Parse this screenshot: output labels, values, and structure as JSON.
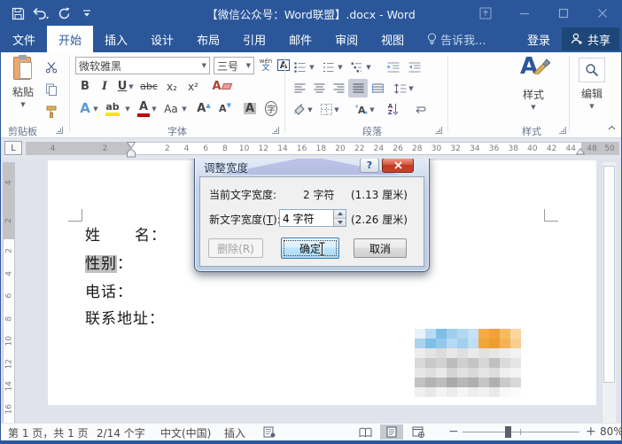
{
  "window": {
    "title": "【微信公众号：Word联盟】.docx - Word"
  },
  "tabs": {
    "file": "文件",
    "home": "开始",
    "insert": "插入",
    "design": "设计",
    "layout": "布局",
    "references": "引用",
    "mailings": "邮件",
    "review": "审阅",
    "view": "视图",
    "tell_me": "告诉我...",
    "sign_in": "登录",
    "share": "共享"
  },
  "ribbon": {
    "clipboard": {
      "paste": "粘贴",
      "label": "剪贴板"
    },
    "font": {
      "label": "字体",
      "font_name": "微软雅黑",
      "font_size": "三号",
      "bold": "B",
      "italic": "I",
      "underline": "U",
      "strikethrough": "abc",
      "subscript": "x₂",
      "superscript": "x²",
      "change_case": "Aa",
      "phonetic_top": "wén",
      "phonetic_bottom": "文",
      "effects_a": "A",
      "highlight_ab": "ab",
      "color_a": "A",
      "grow_a": "A",
      "shrink_a": "A",
      "shade_a": "A",
      "border_a": "A",
      "enclose": "字"
    },
    "paragraph": {
      "label": "段落",
      "sort_a": "A",
      "sort_z": "Z"
    },
    "styles": {
      "label": "样式",
      "big_a": "A"
    },
    "editing": {
      "label": "编辑"
    }
  },
  "ruler": {
    "tab_selector": "L",
    "left_numbers": [
      "4",
      "2"
    ],
    "main_numbers": [
      "2",
      "4",
      "6",
      "8",
      "10",
      "12",
      "14",
      "16",
      "18",
      "20",
      "22",
      "24",
      "26",
      "28",
      "30",
      "32",
      "34",
      "36",
      "38",
      "40",
      "42",
      "44"
    ],
    "right_numbers": [
      "48",
      "50"
    ],
    "vertical_gray": [
      "4",
      "2"
    ],
    "vertical_white": [
      "2",
      "4",
      "6",
      "8",
      "10",
      "12",
      "14",
      "16"
    ]
  },
  "document": {
    "line1_char1": "姓",
    "line1_rest": "名：",
    "line2_selected": "性别",
    "line2_colon": "：",
    "line3": "电话：",
    "line4": "联系地址：",
    "mosaic": [
      "#e8f2fa",
      "#b9dcf4",
      "#7ebfe8",
      "#9fcfef",
      "#b2d8f2",
      "#c6e2f6",
      "#f5ae45",
      "#f2a238",
      "#f7bc5e",
      "#fad79f",
      "#a9d4f0",
      "#7fc0e8",
      "#95c9ec",
      "#b5daf3",
      "#a2cfee",
      "#c0def4",
      "#f2a53c",
      "#ef9c30",
      "#f5b255",
      "#f8cd8e",
      "#ececec",
      "#e4e4e4",
      "#dcdcdc",
      "#e8e8e8",
      "#e0e0e0",
      "#eaeaea",
      "#e2e2e2",
      "#e6e6e6",
      "#ededed",
      "#f2f2f2",
      "#d8d8d8",
      "#c9c9c9",
      "#d2d2d2",
      "#bcbcbc",
      "#cfcfcf",
      "#c4c4c4",
      "#d6d6d6",
      "#c0c0c0",
      "#dadada",
      "#e4e4e4",
      "#e6e6e6",
      "#dedede",
      "#e9e9e9",
      "#d4d4d4",
      "#e1e1e1",
      "#d9d9d9",
      "#e4e4e4",
      "#dddddd",
      "#efefef",
      "#f4f4f4",
      "#c2c2c2",
      "#b4b4b4",
      "#bebebe",
      "#aaaaaa",
      "#b8b8b8",
      "#aeaeae",
      "#c6c6c6",
      "#b0b0b0",
      "#cacaca",
      "#d8d8d8",
      "#f0f0f0",
      "#e8e8e8",
      "#f4f4f4",
      "#ececec",
      "#f6f6f6",
      "#eeeeee",
      "#f2f2f2",
      "#e9e9e9",
      "#f8f8f8",
      "#fbfbfb"
    ]
  },
  "dialog": {
    "title": "调整宽度",
    "help": "?",
    "close": "✕",
    "current_label": "当前文字宽度:",
    "current_value": "2 字符",
    "current_cm": "(1.13 厘米)",
    "new_label_pre": "新文字宽度(",
    "new_label_key": "T",
    "new_label_post": "):",
    "new_value": "4 字符",
    "new_cm": "(2.26 厘米)",
    "delete_button": "删除(R)",
    "ok_button": "确定",
    "cancel_button": "取消"
  },
  "status_bar": {
    "page_info": "第 1 页，共 1 页",
    "word_count": "2/14 个字",
    "language": "中文(中国)",
    "insert_mode": "插入",
    "zoom_minus": "−",
    "zoom_plus": "+",
    "zoom_level": "80%"
  },
  "colors": {
    "accent": "#2b579a",
    "close_red": "#c8452c",
    "highlight_yellow": "#ffe400",
    "font_color_red": "#c00000",
    "selection_gray": "#bfbfbf"
  }
}
